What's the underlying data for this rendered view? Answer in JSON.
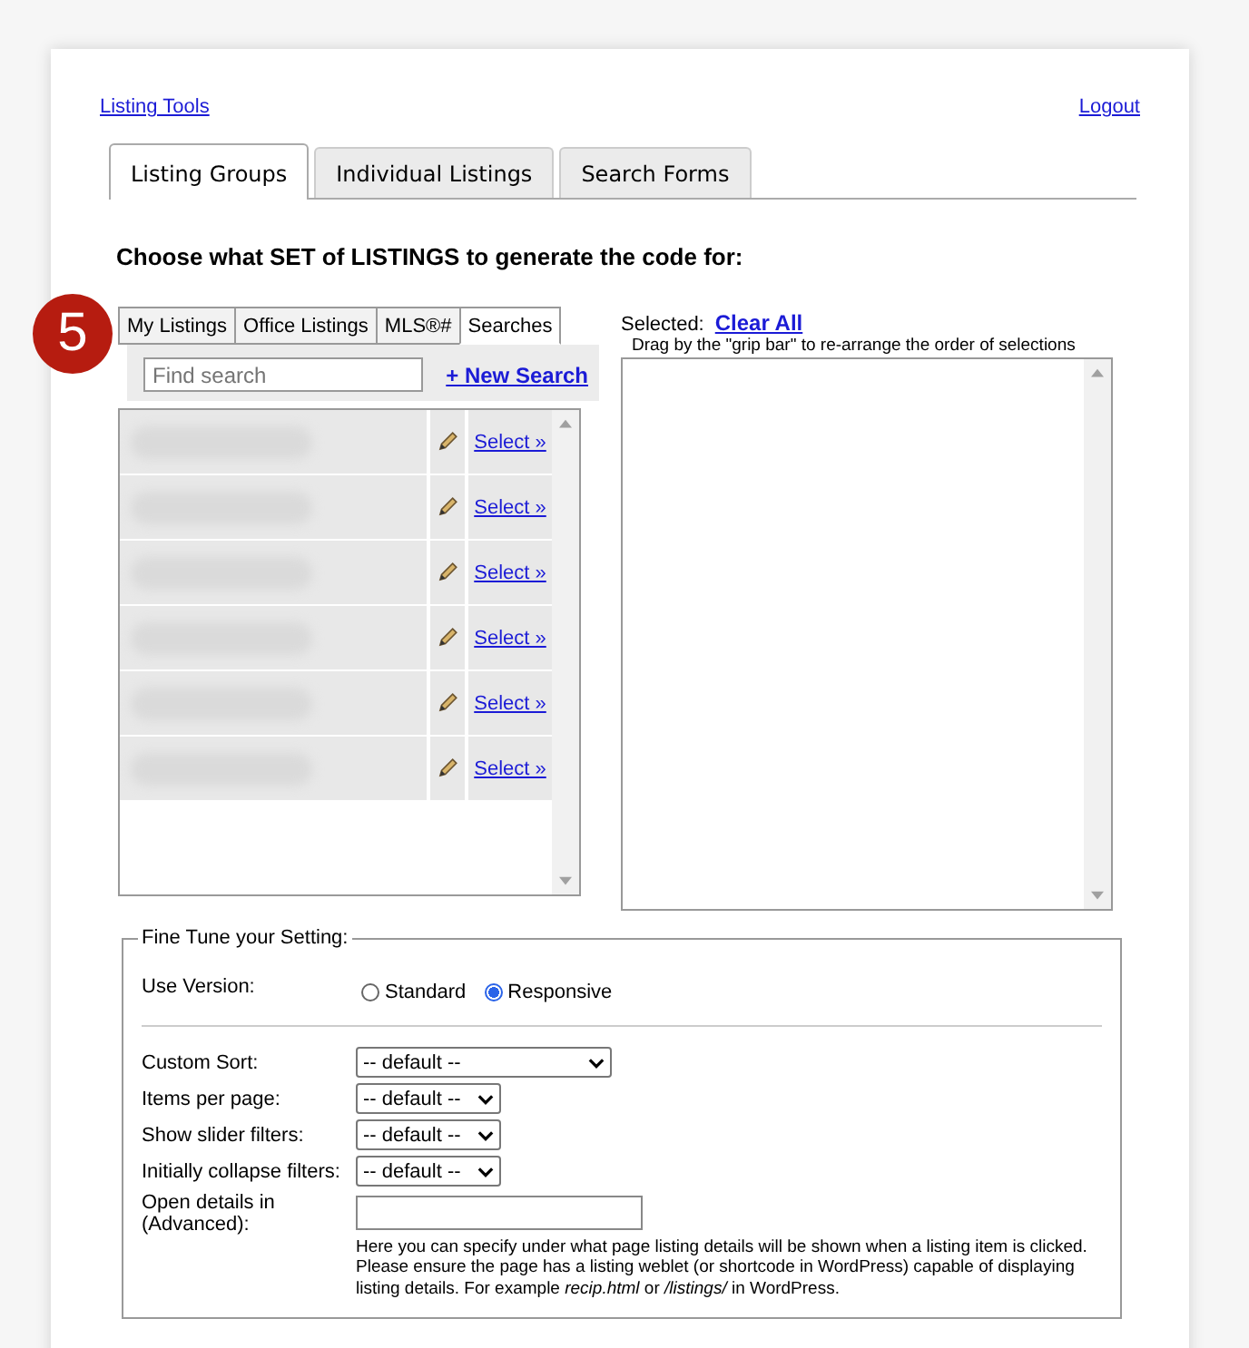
{
  "header": {
    "home_link": "Listing Tools",
    "logout_link": "Logout"
  },
  "tabs": [
    {
      "label": "Listing Groups",
      "selected": true
    },
    {
      "label": "Individual Listings",
      "selected": false
    },
    {
      "label": "Search Forms",
      "selected": false
    }
  ],
  "heading": "Choose what SET of LISTINGS to generate the code for:",
  "step_badge": "5",
  "source_tabs": [
    {
      "label": "My Listings",
      "selected": false
    },
    {
      "label": "Office Listings",
      "selected": false
    },
    {
      "label": "MLS®#",
      "selected": false
    },
    {
      "label": "Searches",
      "selected": true
    }
  ],
  "search": {
    "placeholder": "Find search",
    "new_link": "+ New Search"
  },
  "saved_searches": [
    {
      "select": "Select »"
    },
    {
      "select": "Select »"
    },
    {
      "select": "Select »"
    },
    {
      "select": "Select »"
    },
    {
      "select": "Select »"
    },
    {
      "select": "Select »"
    }
  ],
  "selected_panel": {
    "label": "Selected:",
    "clear_link": "Clear All",
    "hint": "Drag by the \"grip bar\" to re-arrange the order of selections"
  },
  "settings": {
    "legend": "Fine Tune your Setting:",
    "version_label": "Use Version:",
    "versions": [
      {
        "label": "Standard",
        "selected": false
      },
      {
        "label": "Responsive",
        "selected": true
      }
    ],
    "selects": [
      {
        "label": "Custom Sort:",
        "value": "-- default --",
        "wide": true
      },
      {
        "label": "Items per page:",
        "value": "-- default --",
        "wide": false
      },
      {
        "label": "Show slider filters:",
        "value": "-- default --",
        "wide": false
      },
      {
        "label": "Initially collapse filters:",
        "value": "-- default --",
        "wide": false
      }
    ],
    "details_label": "Open details in (Advanced):",
    "details_help": "Here you can specify under what page listing details will be shown when a listing item is clicked. Please ensure the page has a listing weblet (or shortcode in WordPress) capable of displaying listing details. For example *recip.html* or */listings/* in WordPress."
  }
}
